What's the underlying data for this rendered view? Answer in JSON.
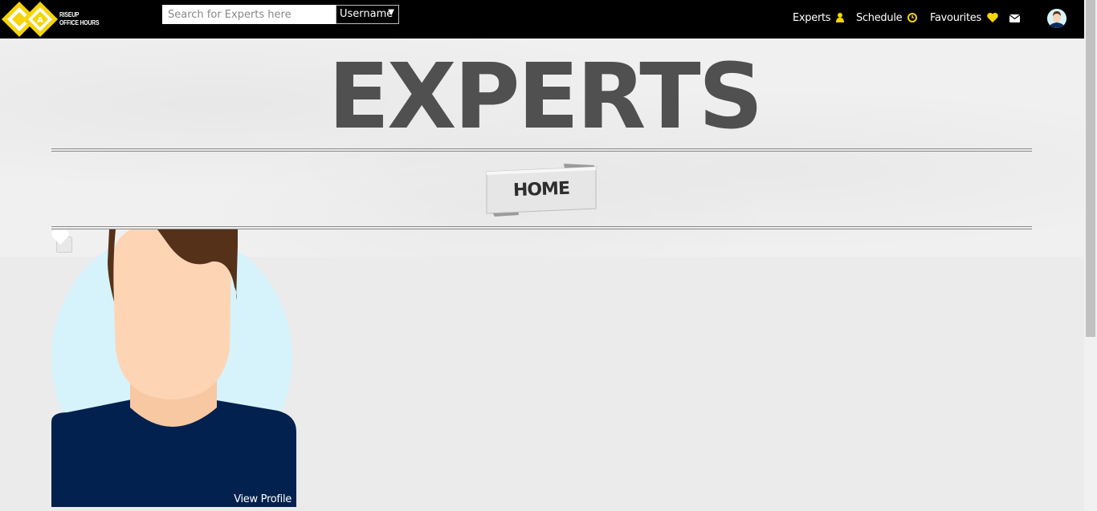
{
  "navbar": {
    "logo_line1": "RISEUP",
    "logo_line2": "OFFICE HOURS",
    "search_placeholder": "Search for Experts here",
    "filter_selected": "Username",
    "items": [
      {
        "label": "Experts",
        "icon": "user-icon"
      },
      {
        "label": "Schedule",
        "icon": "clock-icon"
      },
      {
        "label": "Favourites",
        "icon": "heart-icon"
      }
    ],
    "mail_icon": "envelope-icon",
    "accent_color": "#f5d40b"
  },
  "banner": {
    "title": "EXPERTS",
    "ribbon_label": "HOME"
  },
  "expert_card": {
    "view_profile_label": "View Profile",
    "favourite_icon": "heart-icon"
  }
}
